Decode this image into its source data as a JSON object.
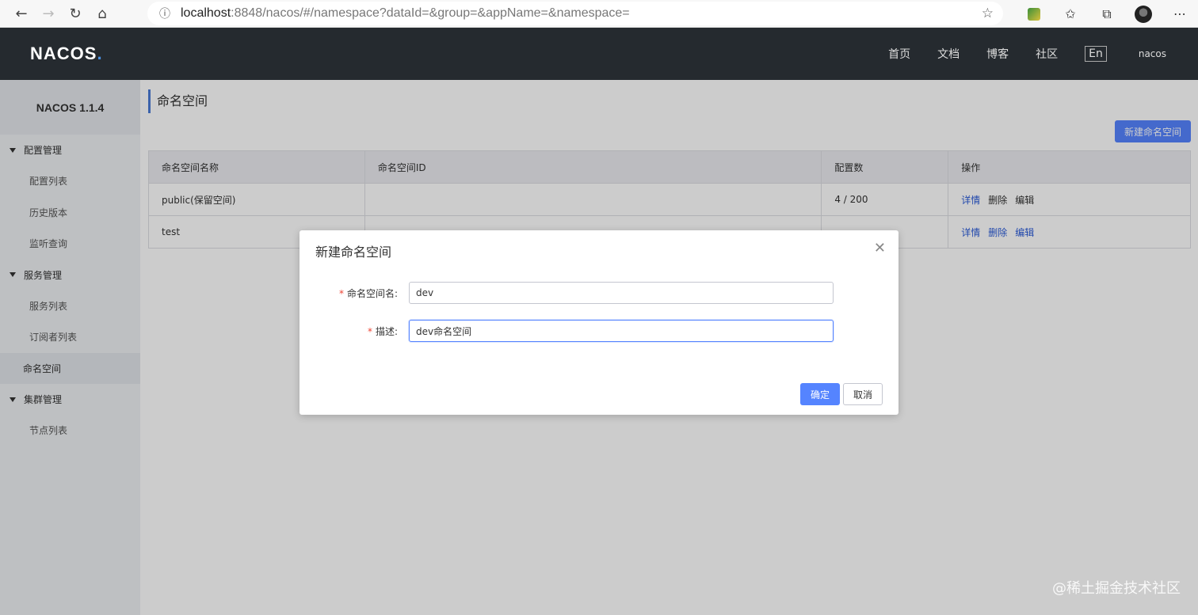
{
  "browser": {
    "url_host": "localhost",
    "url_rest": ":8848/nacos/#/namespace?dataId=&group=&appName=&namespace=",
    "icons": [
      "back-icon",
      "forward-icon",
      "refresh-icon",
      "home-icon",
      "info-icon",
      "star-icon",
      "extension-icon",
      "favorites-icon",
      "collections-icon",
      "profile-avatar",
      "more-icon"
    ]
  },
  "header": {
    "logo_main": "NACOS",
    "logo_dot": ".",
    "nav": [
      "首页",
      "文档",
      "博客",
      "社区"
    ],
    "lang": "En",
    "user": "nacos"
  },
  "sidebar": {
    "title": "NACOS 1.1.4",
    "groups": [
      {
        "label": "配置管理",
        "items": [
          "配置列表",
          "历史版本",
          "监听查询"
        ]
      },
      {
        "label": "服务管理",
        "items": [
          "服务列表",
          "订阅者列表"
        ]
      }
    ],
    "active_item": "命名空间",
    "cluster_group": {
      "label": "集群管理",
      "items": [
        "节点列表"
      ]
    }
  },
  "main": {
    "title": "命名空间",
    "create_button": "新建命名空间",
    "table": {
      "headers": [
        "命名空间名称",
        "命名空间ID",
        "配置数",
        "操作"
      ],
      "rows": [
        {
          "name": "public(保留空间)",
          "id": "",
          "count": "4 / 200"
        },
        {
          "name": "test",
          "id": "",
          "count": ""
        }
      ],
      "actions": {
        "detail": "详情",
        "delete": "删除",
        "edit": "编辑"
      }
    }
  },
  "dialog": {
    "title": "新建命名空间",
    "name_label": "命名空间名:",
    "name_value": "dev",
    "desc_label": "描述:",
    "desc_value": "dev命名空间",
    "required_mark": "*",
    "ok": "确定",
    "cancel": "取消"
  },
  "watermark": "@稀土掘金技术社区",
  "colors": {
    "primary": "#5584ff",
    "header_bg": "#252a2f",
    "link": "#2a5ad8"
  }
}
